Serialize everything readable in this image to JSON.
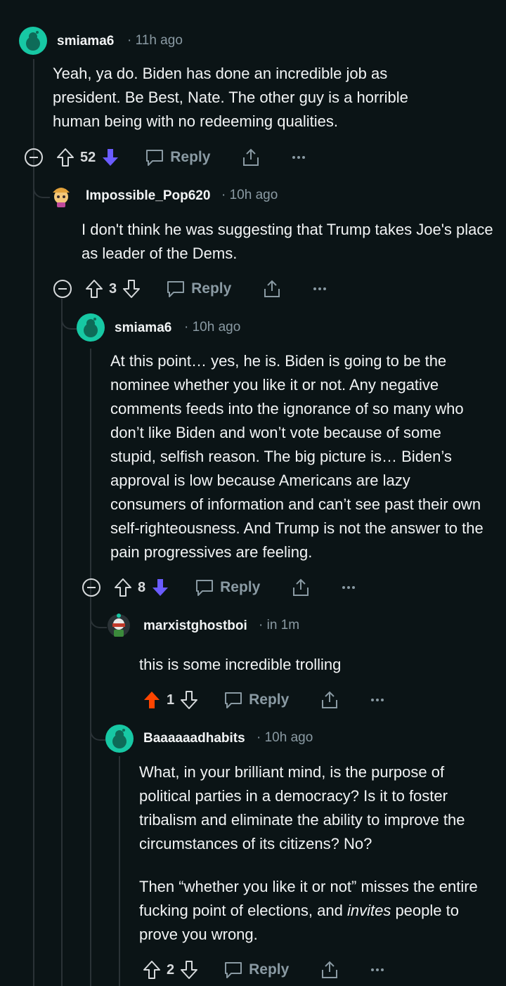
{
  "colors": {
    "background": "#0b1416",
    "upvote_active": "#ff4500",
    "downvote_active": "#6a5cff",
    "muted": "#8a9aa3"
  },
  "comments": [
    {
      "username": "smiama6",
      "time": "11h ago",
      "body": [
        "Yeah, ya do. Biden has done an incredible job as president. Be Best, Nate. The other guy is a horrible human being with no redeeming qualities."
      ],
      "votes": "52",
      "vote_state": "down",
      "reply_label": "Reply"
    },
    {
      "username": "Impossible_Pop620",
      "time": "10h ago",
      "body": [
        "I don't think he was suggesting that Trump takes Joe's place as leader of the Dems."
      ],
      "votes": "3",
      "vote_state": "none",
      "reply_label": "Reply"
    },
    {
      "username": "smiama6",
      "time": "10h ago",
      "body": [
        "At this point… yes, he is. Biden is going to be the nominee whether you like it or not. Any negative comments feeds into the ignorance of so many who don’t like Biden and won’t vote because of some stupid, selfish reason. The big picture is… Biden’s approval is low because Americans are lazy consumers of information and can’t see past their own self-righteousness. And Trump is not the answer to the pain progressives are feeling."
      ],
      "votes": "8",
      "vote_state": "down",
      "reply_label": "Reply"
    },
    {
      "username": "marxistghostboi",
      "time": "in 1m",
      "body": [
        "this is some incredible trolling"
      ],
      "votes": "1",
      "vote_state": "up",
      "reply_label": "Reply"
    },
    {
      "username": "Baaaaaadhabits",
      "time": "10h ago",
      "body": [
        "What, in your brilliant mind, is the purpose of political parties in a democracy? Is it to foster tribalism and eliminate the ability to improve the circumstances of its citizens? No?",
        "Then “whether you like it or not” misses the entire fucking point of elections, and ",
        "invites",
        " people to prove you wrong."
      ],
      "votes": "2",
      "vote_state": "none",
      "reply_label": "Reply"
    }
  ]
}
